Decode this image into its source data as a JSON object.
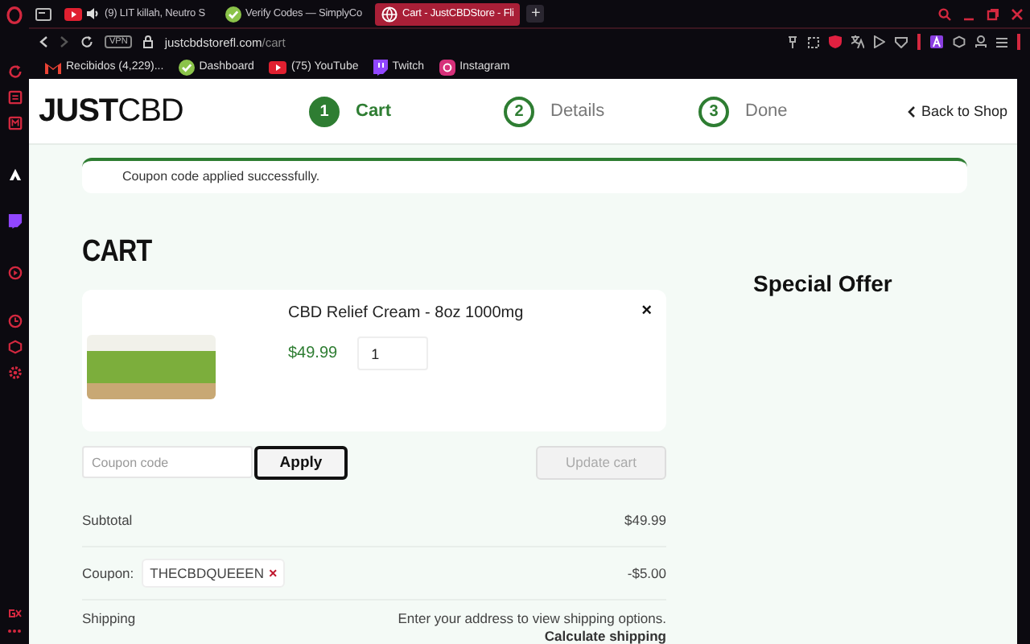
{
  "browser": {
    "tabs": [
      {
        "title": "(9) LIT killah, Neutro S",
        "kind": "youtube",
        "audio": true,
        "selected": false
      },
      {
        "title": "Verify Codes — SimplyCo",
        "kind": "check",
        "audio": false,
        "selected": false
      },
      {
        "title": "Cart - JustCBDStore - Fli",
        "kind": "globe",
        "audio": false,
        "selected": true
      }
    ],
    "new_tab": "+",
    "address": {
      "vpn": "VPN",
      "host": "justcbdstorefl.com",
      "path": "/cart"
    },
    "bookmarks": [
      {
        "label": "Recibidos (4,229)...",
        "kind": "mail"
      },
      {
        "label": "Dashboard",
        "kind": "check"
      },
      {
        "label": "(75) YouTube",
        "kind": "youtube"
      },
      {
        "label": "Twitch",
        "kind": "twitch"
      },
      {
        "label": "Instagram",
        "kind": "instagram"
      }
    ]
  },
  "site": {
    "logo": {
      "bold": "JUST",
      "light": "CBD"
    },
    "steps": [
      {
        "number": "1",
        "label": "Cart",
        "selected": true
      },
      {
        "number": "2",
        "label": "Details",
        "selected": false
      },
      {
        "number": "3",
        "label": "Done",
        "selected": false
      }
    ],
    "back_link": "Back to Shop"
  },
  "notice": "Coupon code applied successfully.",
  "cart": {
    "heading": "CART",
    "items": [
      {
        "name": "CBD Relief Cream - 8oz 1000mg",
        "price": "$49.99",
        "quantity": "1",
        "remove": "×"
      }
    ],
    "coupon_placeholder": "Coupon code",
    "apply": "Apply",
    "update": {
      "label": "Update cart",
      "disabled": true
    }
  },
  "totals": [
    {
      "kind": "plain",
      "label": "Subtotal",
      "value": "$49.99"
    },
    {
      "kind": "coupon",
      "label": "Coupon:",
      "code": "THECBDQUEEEN",
      "remove": "×",
      "value": "-$5.00"
    },
    {
      "kind": "shipping",
      "label": "Shipping",
      "value": "Enter your address to view shipping options.",
      "link": "Calculate shipping"
    }
  ],
  "special_offer": "Special Offer"
}
